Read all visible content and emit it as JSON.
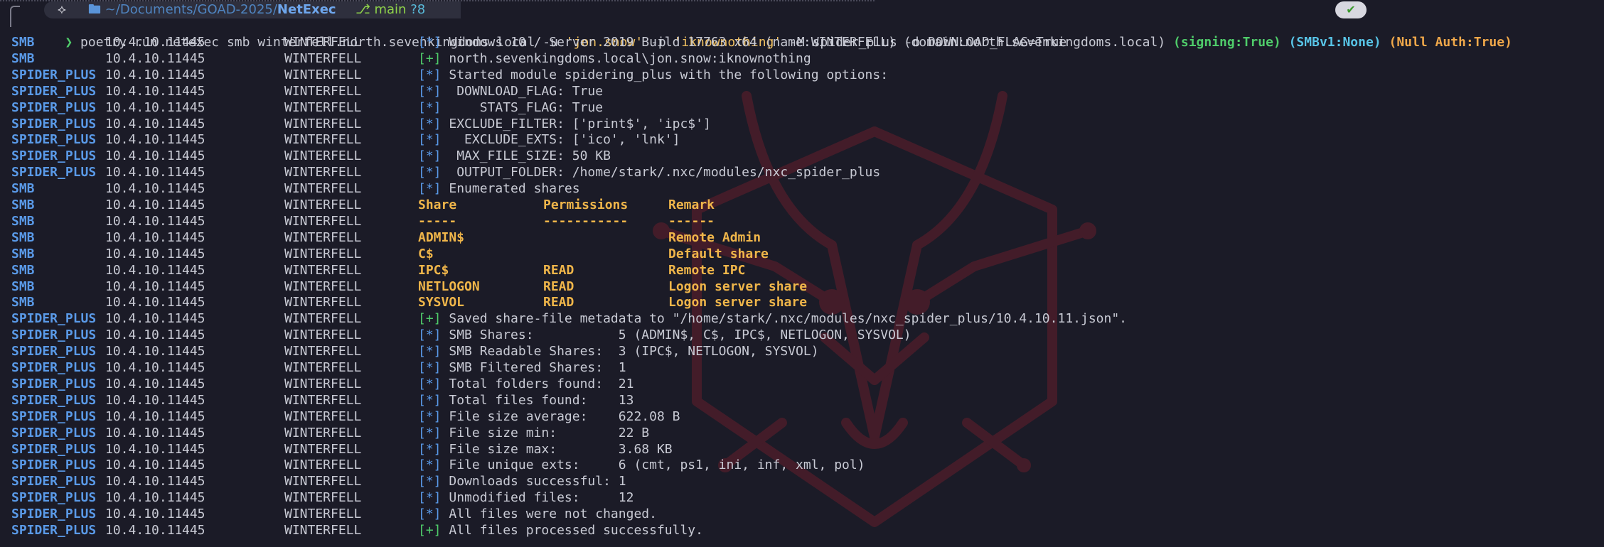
{
  "prompt": {
    "path_prefix": "~/Documents/GOAD-2025/",
    "path_current": "NetExec",
    "git_branch": "main",
    "git_status": "?8",
    "status_ok": "✔"
  },
  "command": {
    "symbol": "❯",
    "pre": "poetry run netexec smb winterfell.north.sevenkingdoms.local -u ",
    "user": "'jon.snow'",
    "mid": " -p ",
    "pass": "'iknownothing'",
    "post": " -M spider_plus -o DOWNLOAD_FLAG=True"
  },
  "output": [
    {
      "mod": "SMB",
      "ip": "10.4.10.11",
      "port": "445",
      "host": "WINTERFELL",
      "tag": "[*]",
      "text": "Windows 10 / Server 2019 Build 17763 x64 (name:WINTERFELL) (domain:north.sevenkingdoms.local) ",
      "extra1": "(signing:True)",
      "extra2": "(SMBv1:None)",
      "extra3": "(Null Auth:True)"
    },
    {
      "mod": "SMB",
      "ip": "10.4.10.11",
      "port": "445",
      "host": "WINTERFELL",
      "tag": "[+]",
      "text": "north.sevenkingdoms.local\\jon.snow:iknownothing"
    },
    {
      "mod": "SPIDER_PLUS",
      "ip": "10.4.10.11",
      "port": "445",
      "host": "WINTERFELL",
      "tag": "[*]",
      "text": "Started module spidering_plus with the following options:"
    },
    {
      "mod": "SPIDER_PLUS",
      "ip": "10.4.10.11",
      "port": "445",
      "host": "WINTERFELL",
      "tag": "[*]",
      "text": " DOWNLOAD_FLAG: True"
    },
    {
      "mod": "SPIDER_PLUS",
      "ip": "10.4.10.11",
      "port": "445",
      "host": "WINTERFELL",
      "tag": "[*]",
      "text": "    STATS_FLAG: True"
    },
    {
      "mod": "SPIDER_PLUS",
      "ip": "10.4.10.11",
      "port": "445",
      "host": "WINTERFELL",
      "tag": "[*]",
      "text": "EXCLUDE_FILTER: ['print$', 'ipc$']"
    },
    {
      "mod": "SPIDER_PLUS",
      "ip": "10.4.10.11",
      "port": "445",
      "host": "WINTERFELL",
      "tag": "[*]",
      "text": "  EXCLUDE_EXTS: ['ico', 'lnk']"
    },
    {
      "mod": "SPIDER_PLUS",
      "ip": "10.4.10.11",
      "port": "445",
      "host": "WINTERFELL",
      "tag": "[*]",
      "text": " MAX_FILE_SIZE: 50 KB"
    },
    {
      "mod": "SPIDER_PLUS",
      "ip": "10.4.10.11",
      "port": "445",
      "host": "WINTERFELL",
      "tag": "[*]",
      "text": " OUTPUT_FOLDER: /home/stark/.nxc/modules/nxc_spider_plus"
    },
    {
      "mod": "SMB",
      "ip": "10.4.10.11",
      "port": "445",
      "host": "WINTERFELL",
      "tag": "[*]",
      "text": "Enumerated shares"
    },
    {
      "mod": "SMB",
      "ip": "10.4.10.11",
      "port": "445",
      "host": "WINTERFELL",
      "share": "Share",
      "perm": "Permissions",
      "remark": "Remark"
    },
    {
      "mod": "SMB",
      "ip": "10.4.10.11",
      "port": "445",
      "host": "WINTERFELL",
      "share": "-----",
      "perm": "-----------",
      "remark": "------"
    },
    {
      "mod": "SMB",
      "ip": "10.4.10.11",
      "port": "445",
      "host": "WINTERFELL",
      "share": "ADMIN$",
      "perm": "",
      "remark": "Remote Admin"
    },
    {
      "mod": "SMB",
      "ip": "10.4.10.11",
      "port": "445",
      "host": "WINTERFELL",
      "share": "C$",
      "perm": "",
      "remark": "Default share"
    },
    {
      "mod": "SMB",
      "ip": "10.4.10.11",
      "port": "445",
      "host": "WINTERFELL",
      "share": "IPC$",
      "perm": "READ",
      "remark": "Remote IPC"
    },
    {
      "mod": "SMB",
      "ip": "10.4.10.11",
      "port": "445",
      "host": "WINTERFELL",
      "share": "NETLOGON",
      "perm": "READ",
      "remark": "Logon server share"
    },
    {
      "mod": "SMB",
      "ip": "10.4.10.11",
      "port": "445",
      "host": "WINTERFELL",
      "share": "SYSVOL",
      "perm": "READ",
      "remark": "Logon server share"
    },
    {
      "mod": "SPIDER_PLUS",
      "ip": "10.4.10.11",
      "port": "445",
      "host": "WINTERFELL",
      "tag": "[+]",
      "text": "Saved share-file metadata to \"/home/stark/.nxc/modules/nxc_spider_plus/10.4.10.11.json\"."
    },
    {
      "mod": "SPIDER_PLUS",
      "ip": "10.4.10.11",
      "port": "445",
      "host": "WINTERFELL",
      "tag": "[*]",
      "text": "SMB Shares:           5 (ADMIN$, C$, IPC$, NETLOGON, SYSVOL)"
    },
    {
      "mod": "SPIDER_PLUS",
      "ip": "10.4.10.11",
      "port": "445",
      "host": "WINTERFELL",
      "tag": "[*]",
      "text": "SMB Readable Shares:  3 (IPC$, NETLOGON, SYSVOL)"
    },
    {
      "mod": "SPIDER_PLUS",
      "ip": "10.4.10.11",
      "port": "445",
      "host": "WINTERFELL",
      "tag": "[*]",
      "text": "SMB Filtered Shares:  1"
    },
    {
      "mod": "SPIDER_PLUS",
      "ip": "10.4.10.11",
      "port": "445",
      "host": "WINTERFELL",
      "tag": "[*]",
      "text": "Total folders found:  21"
    },
    {
      "mod": "SPIDER_PLUS",
      "ip": "10.4.10.11",
      "port": "445",
      "host": "WINTERFELL",
      "tag": "[*]",
      "text": "Total files found:    13"
    },
    {
      "mod": "SPIDER_PLUS",
      "ip": "10.4.10.11",
      "port": "445",
      "host": "WINTERFELL",
      "tag": "[*]",
      "text": "File size average:    622.08 B"
    },
    {
      "mod": "SPIDER_PLUS",
      "ip": "10.4.10.11",
      "port": "445",
      "host": "WINTERFELL",
      "tag": "[*]",
      "text": "File size min:        22 B"
    },
    {
      "mod": "SPIDER_PLUS",
      "ip": "10.4.10.11",
      "port": "445",
      "host": "WINTERFELL",
      "tag": "[*]",
      "text": "File size max:        3.68 KB"
    },
    {
      "mod": "SPIDER_PLUS",
      "ip": "10.4.10.11",
      "port": "445",
      "host": "WINTERFELL",
      "tag": "[*]",
      "text": "File unique exts:     6 (cmt, ps1, ini, inf, xml, pol)"
    },
    {
      "mod": "SPIDER_PLUS",
      "ip": "10.4.10.11",
      "port": "445",
      "host": "WINTERFELL",
      "tag": "[*]",
      "text": "Downloads successful: 1"
    },
    {
      "mod": "SPIDER_PLUS",
      "ip": "10.4.10.11",
      "port": "445",
      "host": "WINTERFELL",
      "tag": "[*]",
      "text": "Unmodified files:     12"
    },
    {
      "mod": "SPIDER_PLUS",
      "ip": "10.4.10.11",
      "port": "445",
      "host": "WINTERFELL",
      "tag": "[*]",
      "text": "All files were not changed."
    },
    {
      "mod": "SPIDER_PLUS",
      "ip": "10.4.10.11",
      "port": "445",
      "host": "WINTERFELL",
      "tag": "[+]",
      "text": "All files processed successfully."
    }
  ],
  "colors": {
    "background": "#1b1b27",
    "module": "#5a9ae8",
    "info_tag": "#5a9ae8",
    "success_tag": "#4fcc6a",
    "share_table": "#f0b64a",
    "watermark": "#7a1e2c"
  }
}
